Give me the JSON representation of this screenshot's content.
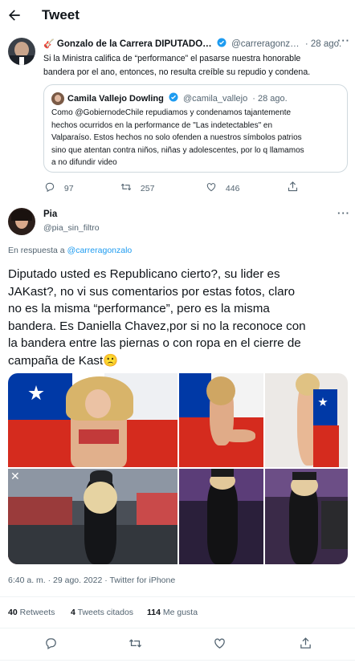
{
  "header": {
    "title": "Tweet"
  },
  "parent_tweet": {
    "display_name": "Gonzalo de la Carrera DIPUTADO…",
    "handle": "@carreragonz…",
    "time": "· 28 ago.",
    "text_lines": [
      "Si la Ministra califica de “performance” el pasarse nuestra honorable",
      "bandera por el ano, entonces, no resulta creíble su repudio y condena."
    ],
    "quoted": {
      "display_name": "Camila Vallejo Dowling",
      "handle": "@camila_vallejo",
      "time": "· 28 ago.",
      "text_lines": [
        "Como @GobiernodeChile repudiamos y condenamos tajantemente",
        "hechos ocurridos en la performance de \"Las indetectables\" en",
        "Valparaíso. Estos hechos no solo ofenden a nuestros símbolos patrios",
        "sino que atentan contra niños, niñas y adolescentes, por lo q llamamos",
        "a no difundir video"
      ]
    },
    "replies": "97",
    "retweets": "257",
    "likes": "446"
  },
  "main_tweet": {
    "display_name": "Pia",
    "handle": "@pia_sin_filtro",
    "reply_prefix": "En respuesta a",
    "reply_to": "@carreragonzalo",
    "text_lines": [
      "Diputado usted es Republicano cierto?, su lider es",
      "JAKast?, no vi sus comentarios por estas fotos, claro",
      "no es la misma “performance”, pero es la misma",
      "bandera. Es Daniella Chavez,por si no la reconoce con",
      "la bandera entre las piernas o con ropa en el cierre de",
      "campaña de Kast🙁"
    ],
    "timestamp": "6:40 a. m. · 29 ago. 2022 · Twitter for iPhone",
    "retweets_count": "40",
    "retweets_label": "Retweets",
    "quotes_count": "4",
    "quotes_label": "Tweets citados",
    "likes_count": "114",
    "likes_label": "Me gusta"
  },
  "colors": {
    "accent": "#1d9bf0",
    "muted": "#536471",
    "border": "#cfd9de",
    "flag_red": "#d52b1e",
    "flag_blue": "#0039a6"
  }
}
